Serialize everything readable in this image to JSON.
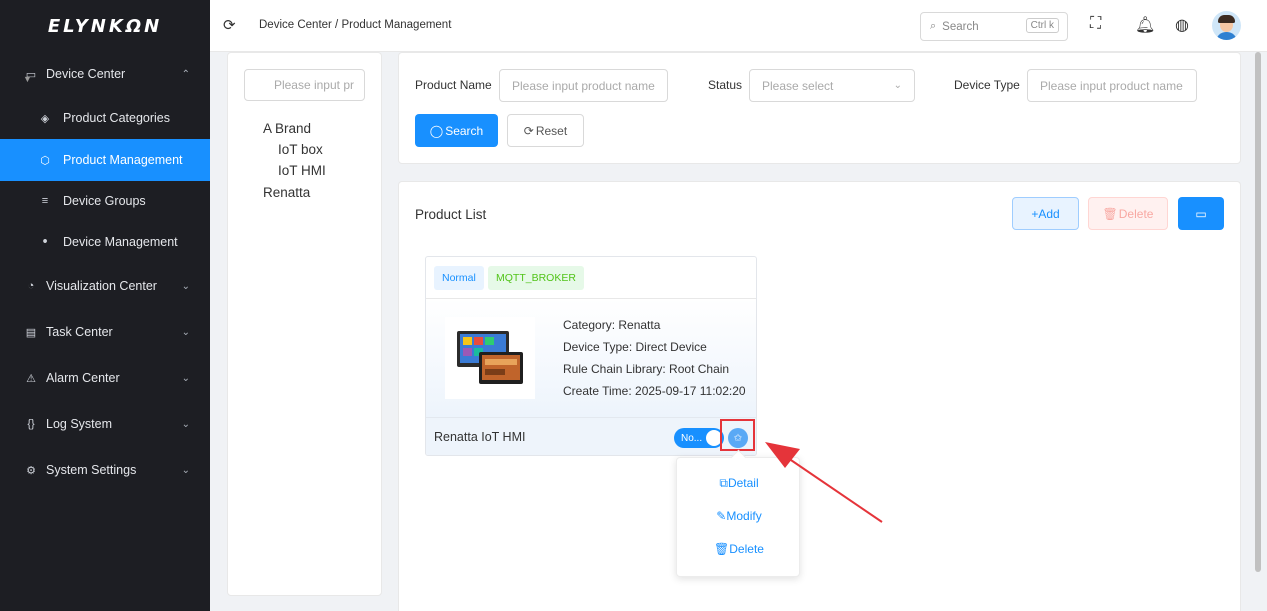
{
  "app": {
    "logo": "ELYNKΩN"
  },
  "sidebar": {
    "items": [
      {
        "label": "Device Center",
        "icon": "monitor-icon",
        "expanded": true
      },
      {
        "label": "Product Categories",
        "icon": "layers-icon"
      },
      {
        "label": "Product Management",
        "icon": "cube-icon",
        "active": true
      },
      {
        "label": "Device Groups",
        "icon": "list-icon"
      },
      {
        "label": "Device Management",
        "icon": "hierarchy-icon"
      },
      {
        "label": "Visualization Center",
        "icon": "pie-chart-icon"
      },
      {
        "label": "Task Center",
        "icon": "clipboard-icon"
      },
      {
        "label": "Alarm Center",
        "icon": "alarm-icon"
      },
      {
        "label": "Log System",
        "icon": "code-icon"
      },
      {
        "label": "System Settings",
        "icon": "gear-icon"
      }
    ]
  },
  "header": {
    "breadcrumb": "Device Center / Product Management",
    "search_placeholder": "Search",
    "search_shortcut": "Ctrl k"
  },
  "tree": {
    "search_placeholder": "Please input pr",
    "nodes": [
      "A Brand",
      "IoT box",
      "IoT HMI",
      "Renatta"
    ]
  },
  "filters": {
    "product_name_label": "Product Name",
    "product_name_placeholder": "Please input product name",
    "status_label": "Status",
    "status_placeholder": "Please select",
    "device_type_label": "Device Type",
    "device_type_placeholder": "Please input product name",
    "search_button": "Search",
    "reset_button": "Reset"
  },
  "list": {
    "title": "Product List",
    "add_button": "+Add",
    "delete_button": "Delete"
  },
  "card": {
    "tags": [
      "Normal",
      "MQTT_BROKER"
    ],
    "category": "Category:  Renatta",
    "device_type": "Device Type:  Direct Device",
    "rule_chain": "Rule Chain Library:  Root Chain",
    "create_time": "Create Time:  2025-09-17 11:02:20",
    "name": "Renatta IoT HMI",
    "toggle_text": "No..."
  },
  "menu": {
    "detail": "Detail",
    "modify": "Modify",
    "delete": "Delete"
  },
  "colors": {
    "sidebar_bg": "#1d1e23",
    "accent": "#1890ff",
    "annotation_red": "#e5343a"
  }
}
